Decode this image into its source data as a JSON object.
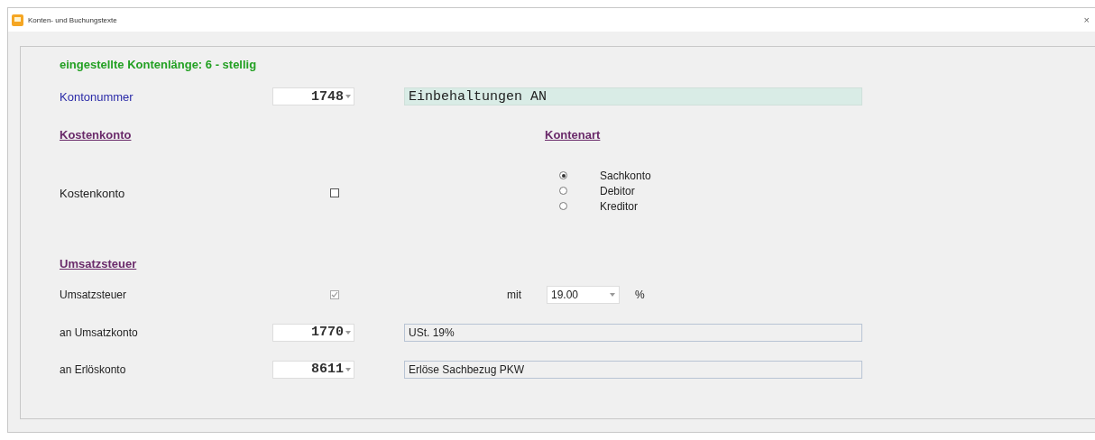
{
  "window": {
    "title": "Konten- und Buchungstexte",
    "close": "×"
  },
  "info": "eingestellte Kontenlänge: 6 - stellig",
  "account": {
    "label": "Kontonummer",
    "number": "1748",
    "name": "Einbehaltungen AN"
  },
  "cost_section": {
    "heading": "Kostenkonto",
    "label": "Kostenkonto",
    "checked": false,
    "disabled": false
  },
  "account_type": {
    "heading": "Kontenart",
    "options": [
      {
        "label": "Sachkonto",
        "selected": true
      },
      {
        "label": "Debitor",
        "selected": false
      },
      {
        "label": "Kreditor",
        "selected": false
      }
    ]
  },
  "vat_section": {
    "heading": "Umsatzsteuer",
    "label": "Umsatzsteuer",
    "checked": true,
    "disabled": true,
    "rate_label": "mit",
    "rate": "19.00",
    "unit": "%"
  },
  "postings": [
    {
      "label": "an Umsatzkonto",
      "number": "1770",
      "text": "USt. 19%"
    },
    {
      "label": "an Erlöskonto",
      "number": "8611",
      "text": "Erlöse Sachbezug PKW"
    }
  ]
}
